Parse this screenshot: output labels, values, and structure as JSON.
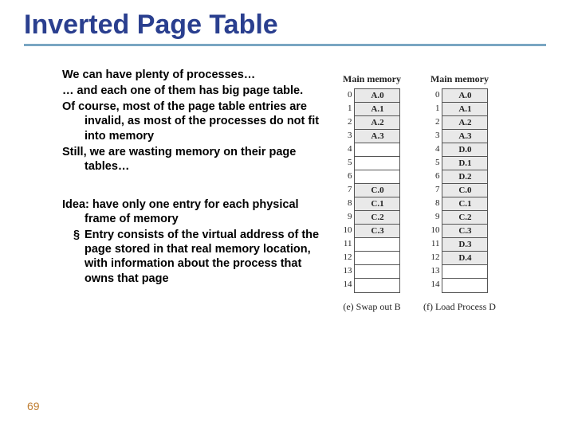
{
  "title": "Inverted Page Table",
  "paras": {
    "p1": "We can have plenty of processes…",
    "p2": "… and each one of them has big page table.",
    "p3": "Of course, most of the page table entries are invalid, as most of the processes do not fit into memory",
    "p4": "Still, we are wasting memory on their page tables…"
  },
  "idea": {
    "lead": "Idea: have only one entry for each physical frame of memory",
    "bullet_mark": "§",
    "bullet": "Entry consists of the virtual address of the page stored in that real memory location, with information about the process that owns that page"
  },
  "page_num": "69",
  "figs": {
    "header": "Main memory",
    "indices": [
      "0",
      "1",
      "2",
      "3",
      "4",
      "5",
      "6",
      "7",
      "8",
      "9",
      "10",
      "11",
      "12",
      "13",
      "14"
    ],
    "e": {
      "cells": [
        "A.0",
        "A.1",
        "A.2",
        "A.3",
        "",
        "",
        "",
        "C.0",
        "C.1",
        "C.2",
        "C.3",
        "",
        "",
        "",
        ""
      ],
      "caption": "(e) Swap out B"
    },
    "f": {
      "cells": [
        "A.0",
        "A.1",
        "A.2",
        "A.3",
        "D.0",
        "D.1",
        "D.2",
        "C.0",
        "C.1",
        "C.2",
        "C.3",
        "D.3",
        "D.4",
        "",
        ""
      ],
      "caption": "(f) Load Process D"
    }
  }
}
